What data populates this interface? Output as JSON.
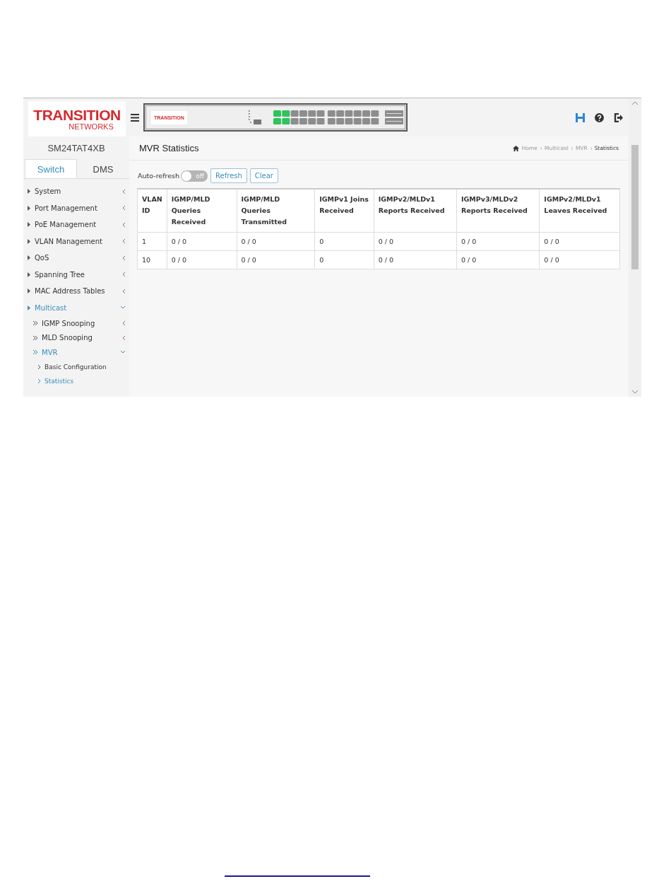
{
  "logo": {
    "line1": "TRANSITION",
    "line2": "NETWORKS"
  },
  "device_panel": {
    "logo": "TRANSITION",
    "ports": [
      {
        "link_up": true
      },
      {
        "link_up": true
      },
      {
        "link_up": true
      },
      {
        "link_up": true
      },
      {
        "link_up": false
      },
      {
        "link_up": false
      },
      {
        "link_up": false
      },
      {
        "link_up": false
      },
      {
        "link_up": false
      },
      {
        "link_up": false
      },
      {
        "link_up": false
      },
      {
        "link_up": false
      },
      {
        "link_up": false
      },
      {
        "link_up": false
      },
      {
        "link_up": false
      },
      {
        "link_up": false
      },
      {
        "link_up": false
      },
      {
        "link_up": false
      },
      {
        "link_up": false
      },
      {
        "link_up": false
      },
      {
        "link_up": false
      },
      {
        "link_up": false
      },
      {
        "link_up": false
      },
      {
        "link_up": false
      }
    ]
  },
  "sidebar": {
    "device_name": "SM24TAT4XB",
    "tabs": [
      {
        "label": "Switch",
        "selected": true
      },
      {
        "label": "DMS",
        "selected": false
      }
    ],
    "items": [
      {
        "label": "System",
        "expanded": false
      },
      {
        "label": "Port Management",
        "expanded": false
      },
      {
        "label": "PoE Management",
        "expanded": false
      },
      {
        "label": "VLAN Management",
        "expanded": false
      },
      {
        "label": "QoS",
        "expanded": false
      },
      {
        "label": "Spanning Tree",
        "expanded": false
      },
      {
        "label": "MAC Address Tables",
        "expanded": false
      },
      {
        "label": "Multicast",
        "expanded": true,
        "children": [
          {
            "label": "IGMP Snooping",
            "expanded": false
          },
          {
            "label": "MLD Snooping",
            "expanded": false
          },
          {
            "label": "MVR",
            "expanded": true,
            "children": [
              {
                "label": "Basic Configuration",
                "selected": false
              },
              {
                "label": "Statistics",
                "selected": true
              }
            ]
          }
        ]
      }
    ]
  },
  "page": {
    "title": "MVR Statistics",
    "breadcrumb": [
      "Home",
      "Multicast",
      "MVR",
      "Statistics"
    ],
    "auto_refresh": {
      "label": "Auto-refresh",
      "on": false,
      "state_text": "off"
    },
    "buttons": [
      "Refresh",
      "Clear"
    ],
    "table": {
      "columns": [
        "VLAN ID",
        "IGMP/MLD Queries Received",
        "IGMP/MLD Queries Transmitted",
        "IGMPv1 Joins Received",
        "IGMPv2/MLDv1 Reports Received",
        "IGMPv3/MLDv2 Reports Received",
        "IGMPv2/MLDv1 Leaves Received"
      ],
      "rows": [
        [
          "1",
          "0 / 0",
          "0 / 0",
          "0",
          "0 / 0",
          "0 / 0",
          "0 / 0"
        ],
        [
          "10",
          "0 / 0",
          "0 / 0",
          "0",
          "0 / 0",
          "0 / 0",
          "0 / 0"
        ]
      ]
    }
  }
}
